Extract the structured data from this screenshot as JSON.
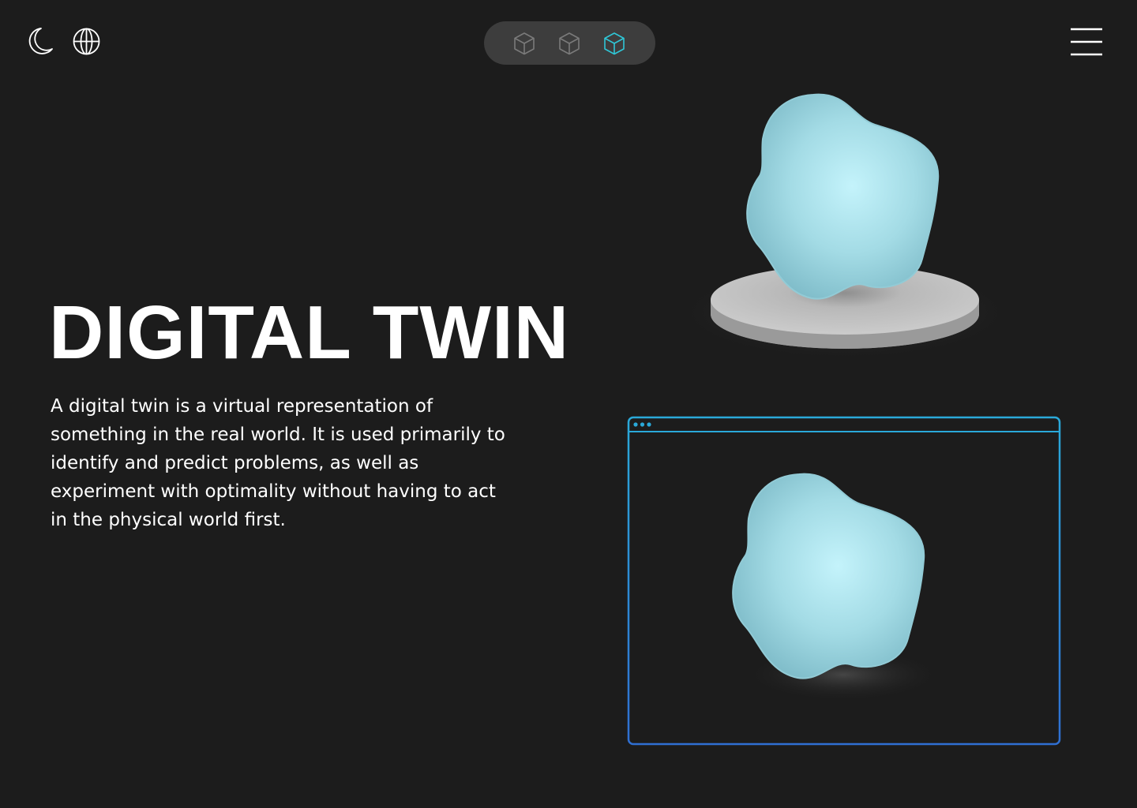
{
  "header": {
    "icons": {
      "theme_toggle": "moon-icon",
      "language": "globe-icon",
      "menu": "hamburger-menu-icon"
    },
    "view_switcher": {
      "items": [
        {
          "icon": "cube-icon",
          "active": false
        },
        {
          "icon": "cube-icon",
          "active": false
        },
        {
          "icon": "cube-icon",
          "active": true
        }
      ]
    }
  },
  "hero": {
    "title": "DIGITAL TWIN",
    "description": "A digital twin is a virtual representation of something in the real world. It is used primarily to identify and predict problems, as well as experiment with optimality without having to act in the physical world first."
  },
  "colors": {
    "background": "#1c1c1c",
    "switcher_bg": "#3d3d3d",
    "cube_inactive": "#7a7a7a",
    "cube_active": "#2fc6d6",
    "blob": "#a6dde6",
    "pedestal": "#c9c9c9",
    "window_border_top": "#2aa9d9",
    "window_border_bottom": "#2f6fd2"
  }
}
